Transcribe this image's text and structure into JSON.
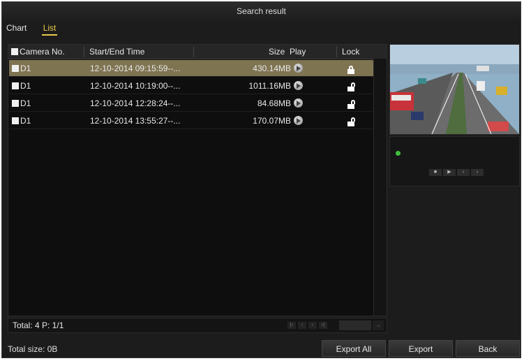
{
  "window": {
    "title": "Search result"
  },
  "tabs": [
    {
      "label": "Chart",
      "active": false
    },
    {
      "label": "List",
      "active": true
    }
  ],
  "table": {
    "headers": {
      "camera": "Camera No.",
      "time": "Start/End Time",
      "size": "Size",
      "play": "Play",
      "lock": "Lock"
    },
    "rows": [
      {
        "camera": "D1",
        "time": "12-10-2014 09:15:59--...",
        "size": "430.14MB",
        "lock_state": "locked",
        "selected": true
      },
      {
        "camera": "D1",
        "time": "12-10-2014 10:19:00--...",
        "size": "1011.16MB",
        "lock_state": "unlocked",
        "selected": false
      },
      {
        "camera": "D1",
        "time": "12-10-2014 12:28:24--...",
        "size": "84.68MB",
        "lock_state": "unlocked",
        "selected": false
      },
      {
        "camera": "D1",
        "time": "12-10-2014 13:55:27--...",
        "size": "170.07MB",
        "lock_state": "unlocked",
        "selected": false
      }
    ]
  },
  "pagination": {
    "text": "Total: 4  P: 1/1"
  },
  "footer": {
    "total_size": "Total size: 0B",
    "export_all": "Export All",
    "export": "Export",
    "back": "Back"
  },
  "colors": {
    "selected_row": "#7f7452",
    "active_tab": "#e8c94a",
    "background": "#1c1c1c"
  },
  "icons": {
    "play": "play-circle-icon",
    "lock": "padlock-icon",
    "checkbox": "checkbox-icon"
  }
}
